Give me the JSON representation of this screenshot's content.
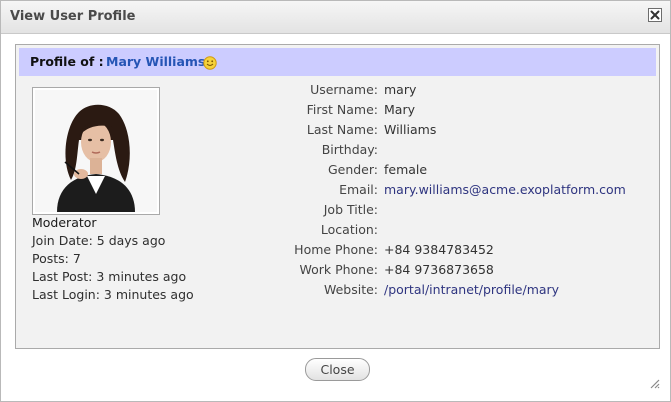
{
  "dialog": {
    "title": "View User Profile",
    "close_button_label": "Close"
  },
  "profile": {
    "header_label": "Profile of :",
    "full_name": "Mary Williams",
    "role": "Moderator",
    "stats": {
      "join_date": "Join Date: 5 days ago",
      "posts": "Posts: 7",
      "last_post": "Last Post: 3 minutes ago",
      "last_login": "Last Login: 3 minutes ago"
    },
    "fields": {
      "username": {
        "label": "Username:",
        "value": "mary"
      },
      "first_name": {
        "label": "First Name:",
        "value": "Mary"
      },
      "last_name": {
        "label": "Last Name:",
        "value": "Williams"
      },
      "birthday": {
        "label": "Birthday:",
        "value": ""
      },
      "gender": {
        "label": "Gender:",
        "value": "female"
      },
      "email": {
        "label": "Email:",
        "value": "mary.williams@acme.exoplatform.com"
      },
      "job_title": {
        "label": "Job Title:",
        "value": ""
      },
      "location": {
        "label": "Location:",
        "value": ""
      },
      "home_phone": {
        "label": "Home Phone:",
        "value": "+84 9384783452"
      },
      "work_phone": {
        "label": "Work Phone:",
        "value": "+84 9736873658"
      },
      "website": {
        "label": "Website:",
        "value": "/portal/intranet/profile/mary"
      }
    }
  },
  "icons": {
    "close": "close-icon",
    "smiley": "smiley-icon",
    "resize": "resize-grip-icon"
  },
  "colors": {
    "header_band": "#ccccff",
    "name_link": "#2555b5",
    "value_link": "#2f3580",
    "panel_background": "#f2f2f2"
  }
}
